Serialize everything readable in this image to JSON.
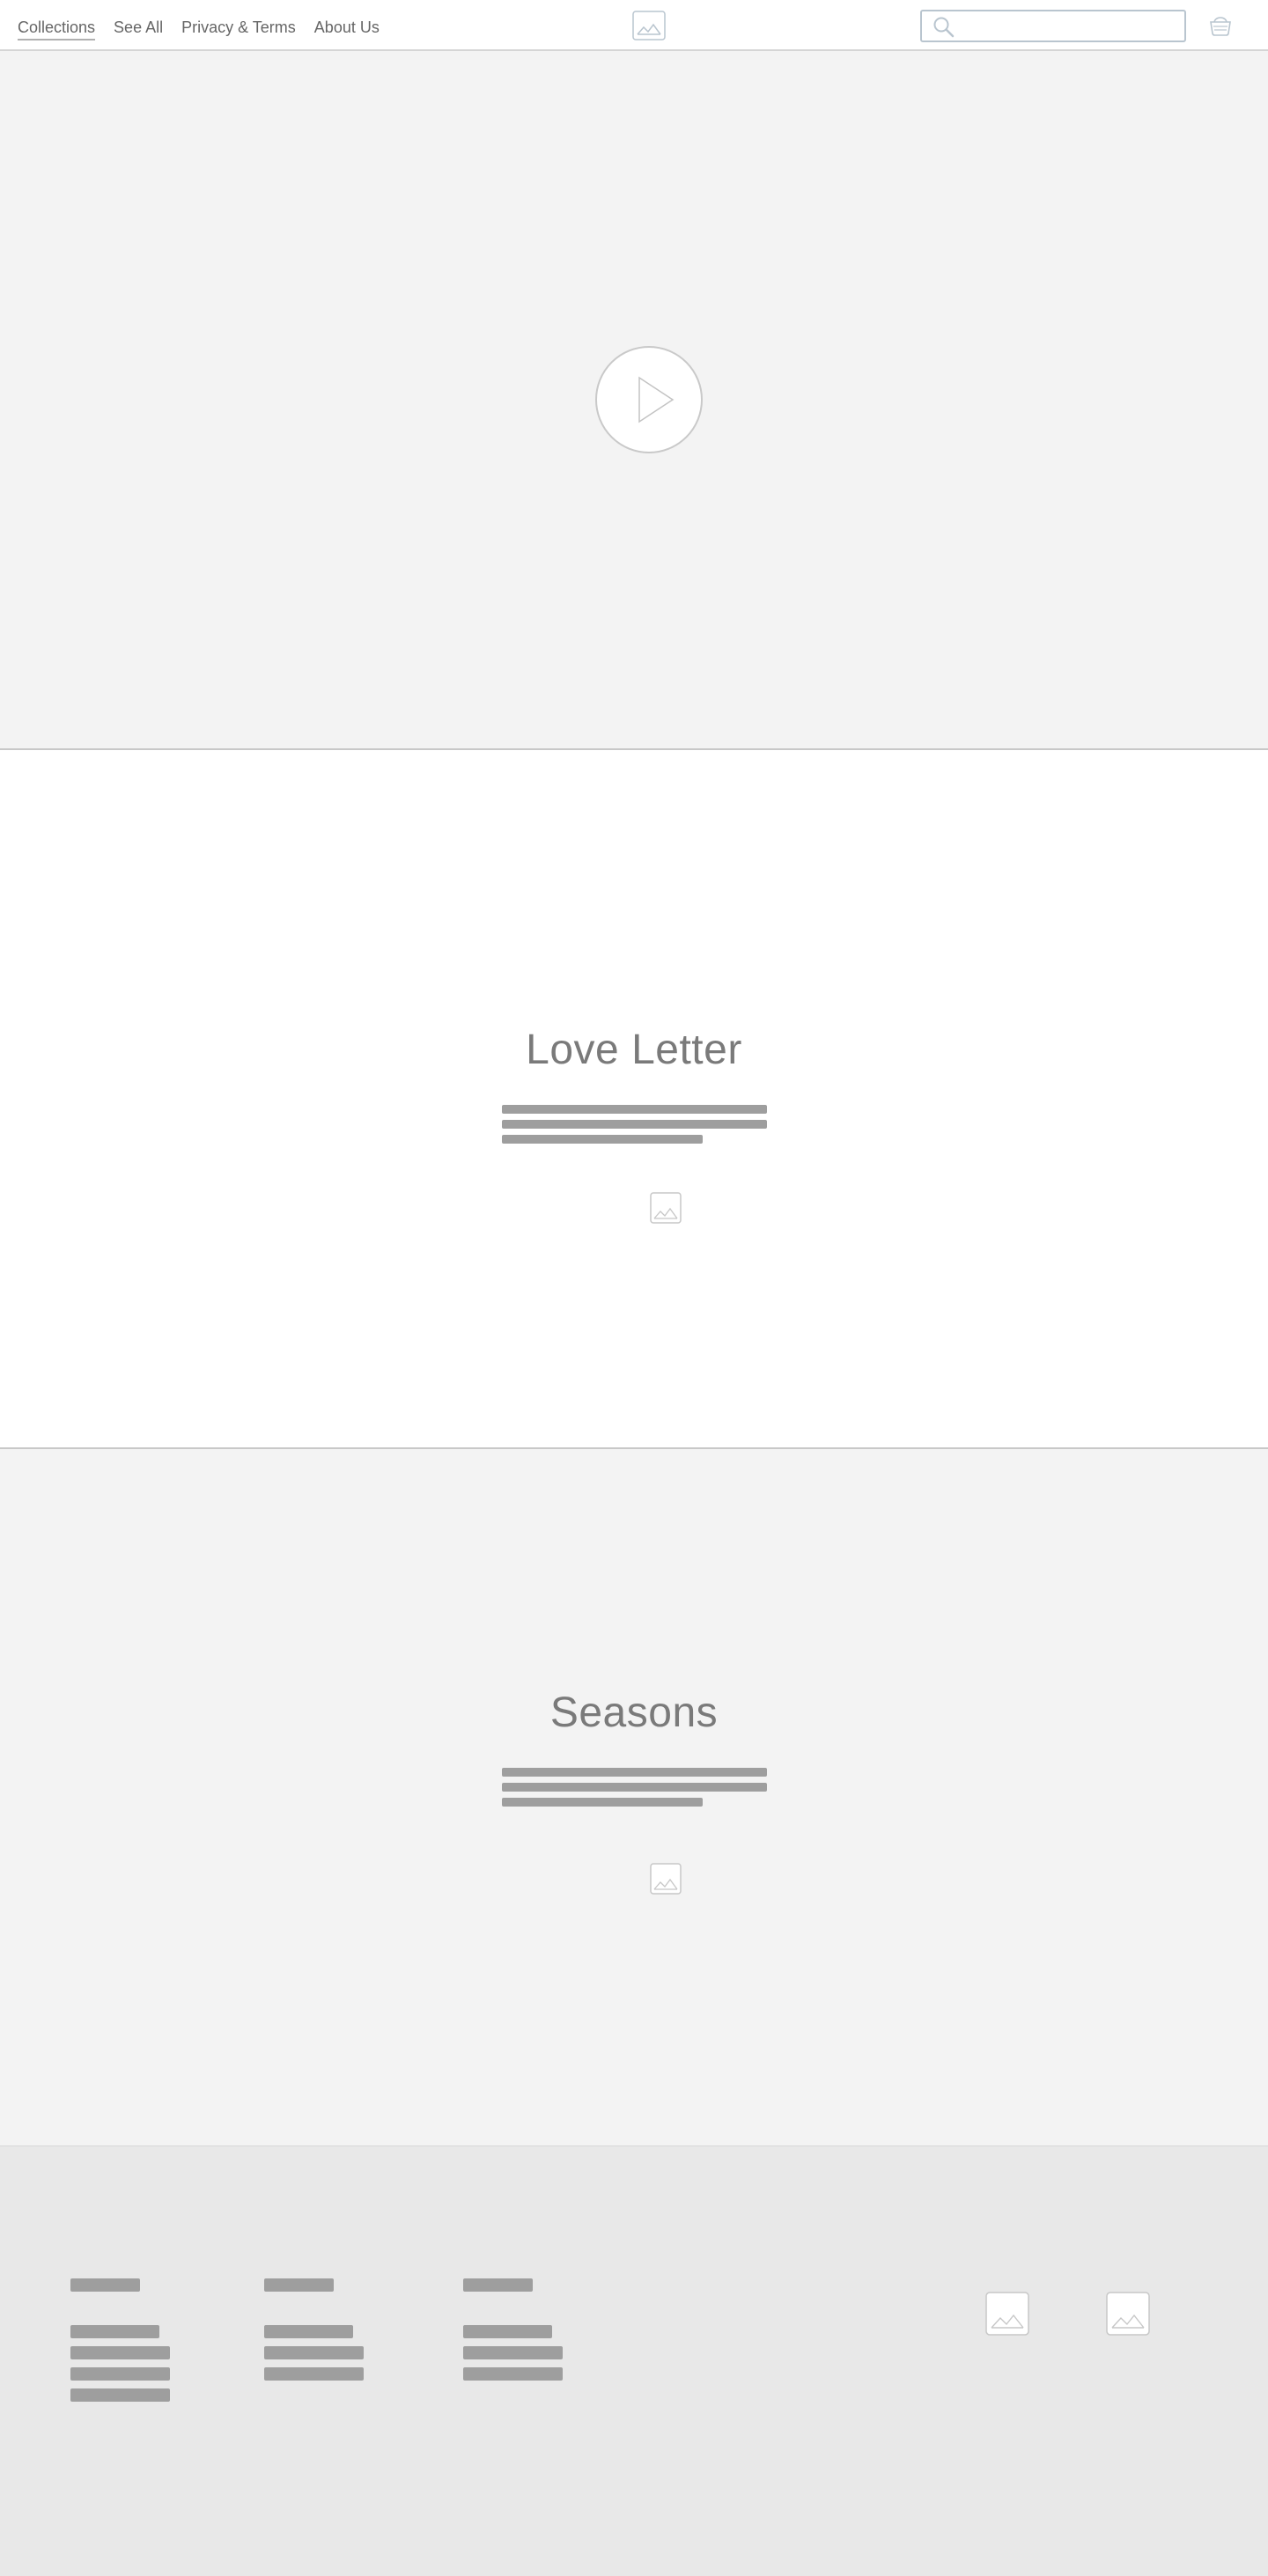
{
  "nav": {
    "items": [
      {
        "label": "Collections",
        "active": true
      },
      {
        "label": "See All",
        "active": false
      },
      {
        "label": "Privacy & Terms",
        "active": false
      },
      {
        "label": "About Us",
        "active": false
      }
    ]
  },
  "header": {
    "logo_icon": "image-placeholder-icon",
    "search": {
      "placeholder": "",
      "value": "",
      "icon": "search-icon"
    },
    "cart_icon": "basket-icon"
  },
  "hero": {
    "play_icon": "play-icon"
  },
  "collections": [
    {
      "title": "Love Letter",
      "thumb_icon": "image-placeholder-icon"
    },
    {
      "title": "Seasons",
      "thumb_icon": "image-placeholder-icon"
    }
  ],
  "footer": {
    "thumb_icons": [
      "image-placeholder-icon",
      "image-placeholder-icon"
    ]
  },
  "colors": {
    "page_bg": "#ffffff",
    "section_alt_bg": "#f3f3f3",
    "footer_bg": "#e8e8e8",
    "placeholder_bar": "#9e9e9e",
    "title_text": "#7a7a7a",
    "search_border": "#b9c5cf"
  }
}
